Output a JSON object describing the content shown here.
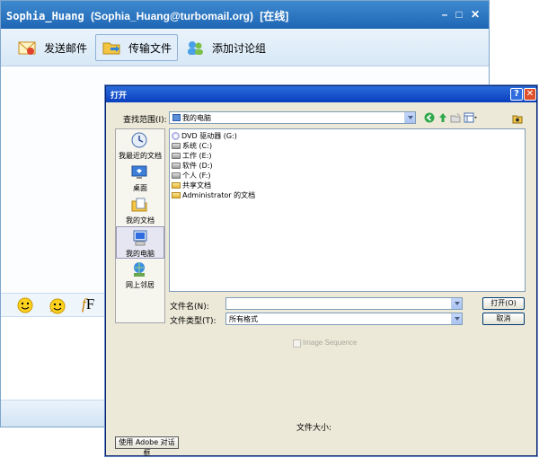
{
  "chat": {
    "title_name": "Sophia_Huang",
    "title_email": "(Sophia_Huang@turbomail.org)",
    "title_status": "[在线]",
    "toolbar": {
      "send_mail": "发送邮件",
      "transfer_file": "传输文件",
      "add_discussion": "添加讨论组"
    },
    "font_button": "F"
  },
  "dialog": {
    "title": "打开",
    "look_in_label": "查找范围(I):",
    "look_in_value": "我的电脑",
    "places": [
      {
        "label": "我最近的文档",
        "icon": "recent-docs-icon"
      },
      {
        "label": "桌面",
        "icon": "desktop-icon"
      },
      {
        "label": "我的文档",
        "icon": "my-documents-icon"
      },
      {
        "label": "我的电脑",
        "icon": "my-computer-icon",
        "selected": true
      },
      {
        "label": "网上邻居",
        "icon": "network-icon"
      }
    ],
    "files": [
      {
        "name": "DVD 驱动器 (G:)",
        "icon": "dvd-drive-icon"
      },
      {
        "name": "系统 (C:)",
        "icon": "drive-icon"
      },
      {
        "name": "工作 (E:)",
        "icon": "drive-icon"
      },
      {
        "name": "软件 (D:)",
        "icon": "drive-icon"
      },
      {
        "name": "个人 (F:)",
        "icon": "drive-icon"
      },
      {
        "name": "共享文档",
        "icon": "folder-icon"
      },
      {
        "name": "Administrator 的文档",
        "icon": "folder-icon"
      }
    ],
    "filename_label": "文件名(N):",
    "filename_value": "",
    "filetype_label": "文件类型(T):",
    "filetype_value": "所有格式",
    "open_button": "打开(O)",
    "cancel_button": "取消",
    "image_sequence_label": "Image Sequence",
    "file_size_label": "文件大小:",
    "adobe_dialog_button": "使用 Adobe 对话框"
  }
}
